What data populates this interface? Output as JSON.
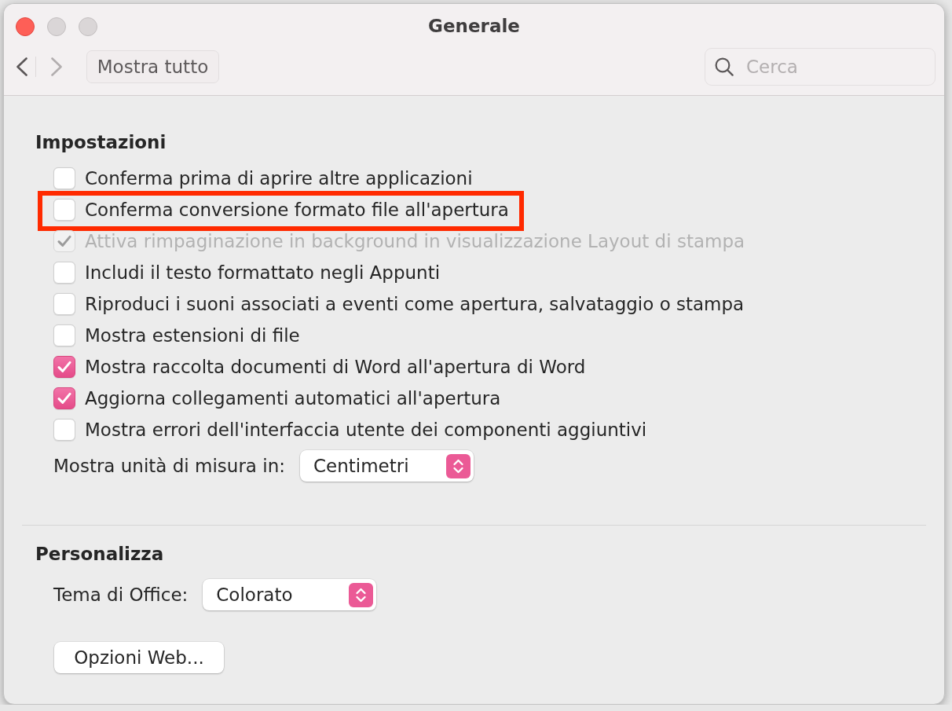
{
  "window": {
    "title": "Generale",
    "buttons": [
      {
        "kind": "close",
        "disabled": false
      },
      {
        "kind": "minimize",
        "disabled": true
      },
      {
        "kind": "zoom",
        "disabled": true
      }
    ]
  },
  "toolbar": {
    "back": {
      "disabled": false
    },
    "forward": {
      "disabled": true
    },
    "show_all": "Mostra tutto",
    "search": {
      "placeholder": "Cerca"
    }
  },
  "sections": [
    {
      "title": "Impostazioni",
      "items": [
        {
          "kind": "checkbox",
          "label": "Conferma prima di aprire altre applicazioni",
          "checked": false,
          "disabled": false,
          "highlighted": false
        },
        {
          "kind": "checkbox",
          "label": "Conferma conversione formato file all'apertura",
          "checked": false,
          "disabled": false,
          "highlighted": true
        },
        {
          "kind": "checkbox",
          "label": "Attiva rimpaginazione in background in visualizzazione Layout di stampa",
          "checked": true,
          "disabled": true,
          "highlighted": false
        },
        {
          "kind": "checkbox",
          "label": "Includi il testo formattato negli Appunti",
          "checked": false,
          "disabled": false,
          "highlighted": false
        },
        {
          "kind": "checkbox",
          "label": "Riproduci i suoni associati a eventi come apertura, salvataggio o stampa",
          "checked": false,
          "disabled": false,
          "highlighted": false
        },
        {
          "kind": "checkbox",
          "label": "Mostra estensioni di file",
          "checked": false,
          "disabled": false,
          "highlighted": false
        },
        {
          "kind": "checkbox",
          "label": "Mostra raccolta documenti di Word all'apertura di Word",
          "checked": true,
          "disabled": false,
          "highlighted": false
        },
        {
          "kind": "checkbox",
          "label": "Aggiorna collegamenti automatici all'apertura",
          "checked": true,
          "disabled": false,
          "highlighted": false
        },
        {
          "kind": "checkbox",
          "label": "Mostra errori dell'interfaccia utente dei componenti aggiuntivi",
          "checked": false,
          "disabled": false,
          "highlighted": false
        },
        {
          "kind": "popup",
          "label": "Mostra unità di misura in:",
          "value": "Centimetri",
          "highlighted": false
        }
      ]
    },
    {
      "title": "Personalizza",
      "items": [
        {
          "kind": "popup",
          "label": "Tema di Office:",
          "value": "Colorato",
          "highlighted": false
        },
        {
          "kind": "button",
          "label": "Opzioni Web...",
          "highlighted": false
        }
      ]
    }
  ]
}
